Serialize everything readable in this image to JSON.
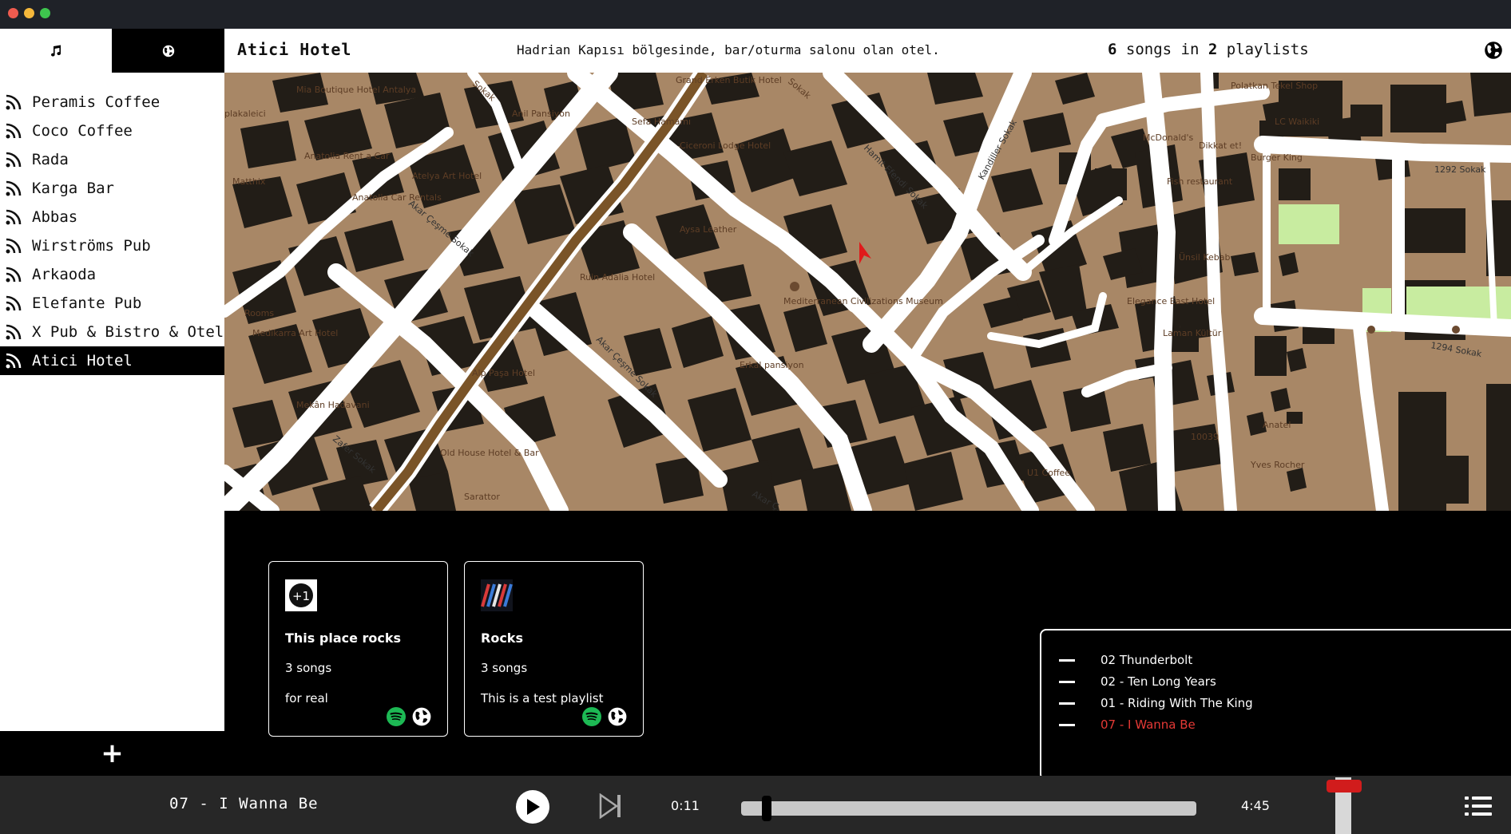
{
  "sidebar": {
    "tabs": [
      {
        "name": "music-note-icon",
        "active": false
      },
      {
        "name": "globe-icon",
        "active": true
      }
    ],
    "items": [
      {
        "label": "Peramis Coffee",
        "selected": false
      },
      {
        "label": "Coco Coffee",
        "selected": false
      },
      {
        "label": "Rada",
        "selected": false
      },
      {
        "label": "Karga Bar",
        "selected": false
      },
      {
        "label": "Abbas",
        "selected": false
      },
      {
        "label": "Wirströms Pub",
        "selected": false
      },
      {
        "label": "Arkaoda",
        "selected": false
      },
      {
        "label": "Elefante Pub",
        "selected": false
      },
      {
        "label": "X Pub & Bistro & Otel",
        "selected": false
      },
      {
        "label": "Atici Hotel",
        "selected": true
      }
    ],
    "add_label": "+"
  },
  "header": {
    "title": "Atici Hotel",
    "description": "Hadrian Kapısı bölgesinde, bar/oturma salonu olan otel.",
    "count_prefix": "6",
    "count_mid": " songs in ",
    "count_num2": "2",
    "count_suffix": " playlists",
    "icon": "globe-icon"
  },
  "map": {
    "labels": [
      "Mia Boutique Hotel Antalya",
      "Grand Erken Butik Hotel",
      "Sokak",
      "Sokak",
      "Polatkan Tekel Shop",
      "Anil Pansiyon",
      "Sefa Hamamı",
      "Ciceroni Lodge Hotel",
      "Hamit Efendi Sokak",
      "Kandiller Sokak",
      "McDonald's",
      "Dikkat et!",
      "LC Waikiki",
      "Burger King",
      "1292 Sokak",
      "Fish restaurant",
      "Anatolia Rent a Car",
      "Atelya Art Hotel",
      "Anatolia Car Rentals",
      "Akar Çeşme Sokak",
      "Aysa Leather",
      "Ruin Adalia Hotel",
      "Mediterranean Civilizations Museum",
      "Erkal pansiyon",
      "Rooms",
      "Medikarra Art Hotel",
      "Alp Paşa Hotel",
      "Akar Çeşme Sokak",
      "Elegance East Hotel",
      "Ünsil Kebab",
      "Laman Kültür",
      "1294 Sokak",
      "Mekân Hadavani",
      "Zafer Sokak",
      "Old House Hotel & Bar",
      "Sarattor",
      "Akar Ç...",
      "10039",
      "U1 Coffee",
      "Yves Rocher",
      "Anatel",
      "Matthix",
      "plakaleici"
    ]
  },
  "playlists": [
    {
      "name": "This place rocks",
      "songs": "3 songs",
      "description": "for real",
      "cover": "plus-one-cover-icon"
    },
    {
      "name": "Rocks",
      "songs": "3 songs",
      "description": "This is a test playlist",
      "cover": "striped-cover-icon"
    }
  ],
  "queue": [
    {
      "label": "02 Thunderbolt",
      "current": false
    },
    {
      "label": "02 - Ten Long Years",
      "current": false
    },
    {
      "label": "01 - Riding With The King",
      "current": false
    },
    {
      "label": "07 - I Wanna Be",
      "current": true
    }
  ],
  "player": {
    "title": "07 - I Wanna Be",
    "elapsed": "0:11",
    "total": "4:45",
    "progress_fraction": 0.045,
    "volume_fraction": 0.95,
    "accent": "#d11c1c"
  },
  "colors": {
    "map_land": "#a88766",
    "map_building": "#221d17",
    "map_road": "#ffffff",
    "map_main_road": "#7a5428",
    "map_park": "#c8eca0",
    "queue_current": "#e53935",
    "spotify": "#1db954"
  }
}
